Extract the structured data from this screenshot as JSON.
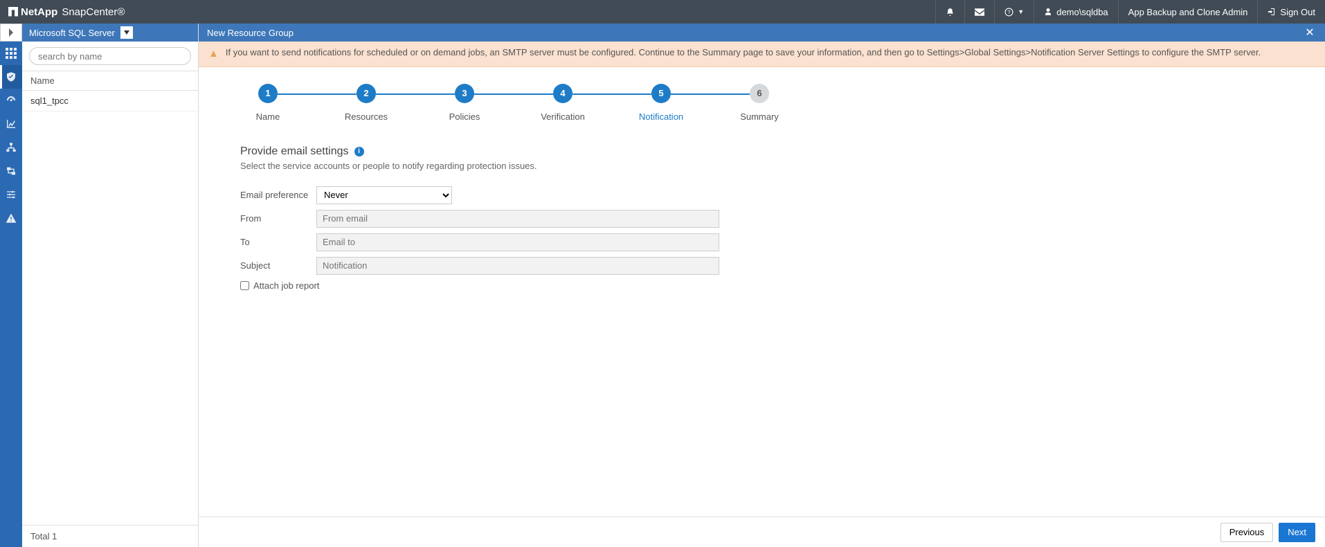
{
  "header": {
    "brand": "NetApp",
    "product": "SnapCenter®",
    "user": "demo\\sqldba",
    "role": "App Backup and Clone Admin",
    "signout": "Sign Out"
  },
  "db_panel": {
    "title": "Microsoft SQL Server",
    "search_placeholder": "search by name",
    "col_header": "Name",
    "rows": [
      "sql1_tpcc"
    ],
    "footer": "Total 1"
  },
  "main": {
    "title": "New Resource Group",
    "banner": "If you want to send notifications for scheduled or on demand jobs, an SMTP server must be configured. Continue to the Summary page to save your information, and then go to Settings>Global Settings>Notification Server Settings to configure the SMTP server."
  },
  "steps": [
    {
      "n": "1",
      "label": "Name"
    },
    {
      "n": "2",
      "label": "Resources"
    },
    {
      "n": "3",
      "label": "Policies"
    },
    {
      "n": "4",
      "label": "Verification"
    },
    {
      "n": "5",
      "label": "Notification"
    },
    {
      "n": "6",
      "label": "Summary"
    }
  ],
  "form": {
    "title": "Provide email settings",
    "subtitle": "Select the service accounts or people to notify regarding protection issues.",
    "pref_label": "Email preference",
    "pref_value": "Never",
    "from_label": "From",
    "from_placeholder": "From email",
    "to_label": "To",
    "to_placeholder": "Email to",
    "subject_label": "Subject",
    "subject_placeholder": "Notification",
    "attach_label": "Attach job report"
  },
  "buttons": {
    "prev": "Previous",
    "next": "Next"
  }
}
